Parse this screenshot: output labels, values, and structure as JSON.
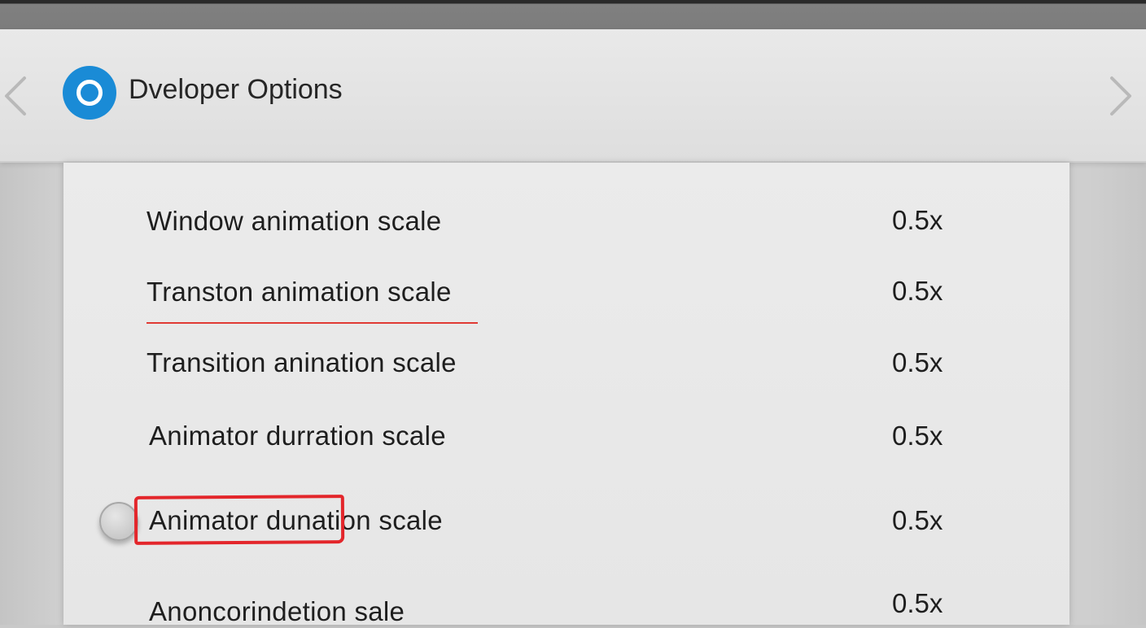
{
  "header": {
    "title": "Dveloper Options",
    "app_icon": "developer-options-icon",
    "prev_icon": "chevron-left-icon",
    "next_icon": "chevron-right-icon"
  },
  "colors": {
    "accent": "#1a8bd6",
    "highlight": "#e3262b",
    "underline": "#e03a34"
  },
  "settings": {
    "rows": [
      {
        "label": "Window animation scale",
        "value": "0.5x"
      },
      {
        "label": "Transton animation scale",
        "value": "0.5x"
      },
      {
        "label": "Transition anination scale",
        "value": "0.5x"
      },
      {
        "label": "Animator durration scale",
        "value": "0.5x"
      },
      {
        "label": "Animator dunation scale",
        "value": "0.5x"
      },
      {
        "label": "Anoncorindetion sale",
        "value": "0.5x"
      }
    ]
  }
}
